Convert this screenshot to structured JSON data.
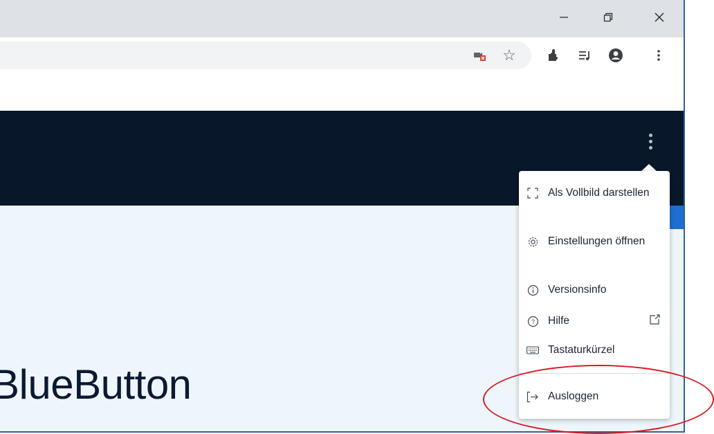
{
  "app": {
    "title": "BlueButton"
  },
  "window_controls": {
    "minimize": "minimize-icon",
    "restore": "restore-icon",
    "close": "close-icon"
  },
  "toolbar_icons": [
    "camera-blocked-icon",
    "star-icon",
    "extensions-icon",
    "media-icon",
    "profile-icon",
    "kebab-menu-icon"
  ],
  "menu": {
    "items": [
      {
        "label": "Als Vollbild darstellen",
        "icon": "fullscreen-icon"
      },
      {
        "label": "Einstellungen öffnen",
        "icon": "gear-icon"
      },
      {
        "label": "Versionsinfo",
        "icon": "info-icon"
      },
      {
        "label": "Hilfe",
        "icon": "help-icon",
        "trailing_icon": "external-link-icon"
      },
      {
        "label": "Tastaturkürzel",
        "icon": "keyboard-icon"
      },
      {
        "label": "Ausloggen",
        "icon": "logout-icon"
      }
    ]
  },
  "colors": {
    "header": "#08172a",
    "content_bg": "#eff6fb",
    "accent_blue": "#1f6fd0",
    "highlight": "#d9191f"
  }
}
